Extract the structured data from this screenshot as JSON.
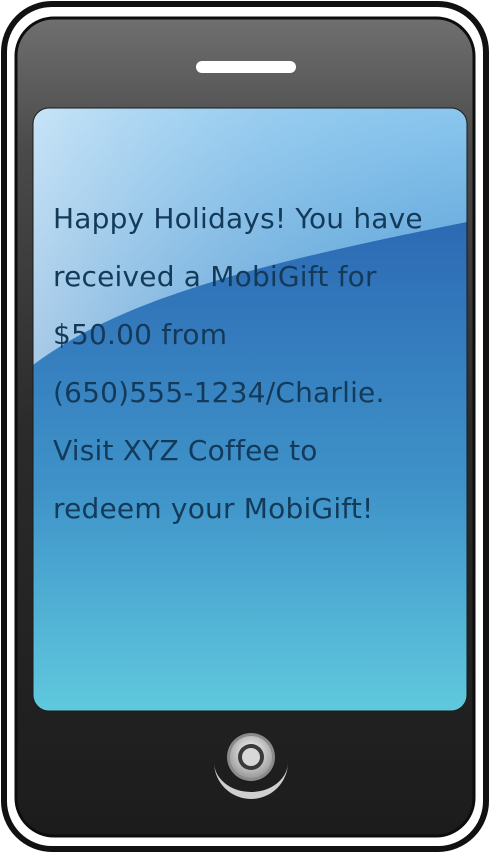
{
  "message": {
    "lines": [
      "Happy Holidays! You have",
      "received a MobiGift for",
      "$50.00 from",
      "(650)555-1234/Charlie.",
      "Visit XYZ Coffee to",
      "redeem your MobiGift!"
    ]
  },
  "icons": {
    "speaker": "speaker-slot-icon",
    "home_button": "home-button-icon"
  },
  "colors": {
    "phone_body": "#2b2b2b",
    "phone_top": "#6e6e6e",
    "screen_top": "#7fbfe8",
    "screen_wave": "#2f6fb8",
    "screen_bottom": "#5fc8dc",
    "text": "#143a5a"
  }
}
